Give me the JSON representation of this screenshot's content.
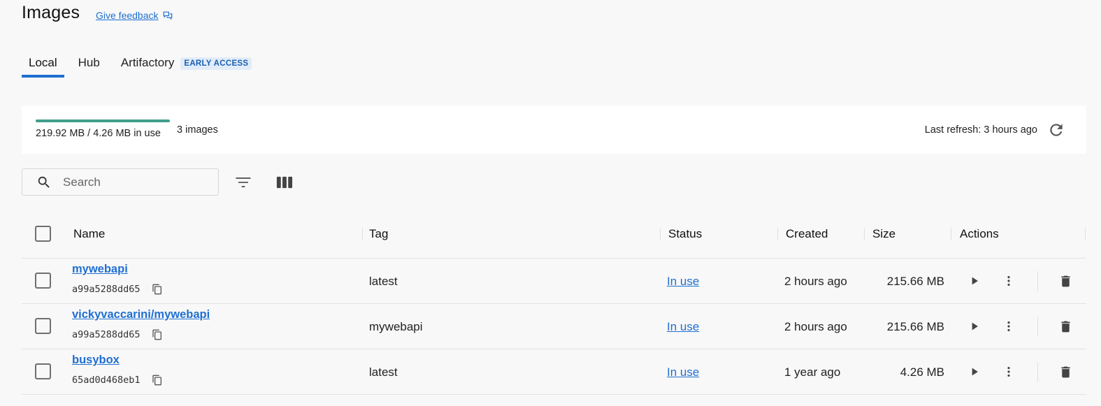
{
  "header": {
    "title": "Images",
    "feedback_label": "Give feedback"
  },
  "tabs": [
    {
      "label": "Local",
      "active": true
    },
    {
      "label": "Hub",
      "active": false
    },
    {
      "label": "Artifactory",
      "active": false,
      "badge": "EARLY ACCESS"
    }
  ],
  "usage": {
    "usage_text": "219.92 MB / 4.26 MB in use",
    "images_count": "3 images",
    "last_refresh": "Last refresh: 3 hours ago",
    "bar_color": "#3f9e8b"
  },
  "search": {
    "placeholder": "Search",
    "value": ""
  },
  "table": {
    "columns": [
      "Name",
      "Tag",
      "Status",
      "Created",
      "Size",
      "Actions"
    ],
    "rows": [
      {
        "name": "mywebapi",
        "id": "a99a5288dd65",
        "tag": "latest",
        "status": "In use",
        "created": "2 hours ago",
        "size": "215.66 MB"
      },
      {
        "name": "vickyvaccarini/mywebapi",
        "id": "a99a5288dd65",
        "tag": "mywebapi",
        "status": "In use",
        "created": "2 hours ago",
        "size": "215.66 MB"
      },
      {
        "name": "busybox",
        "id": "65ad0d468eb1",
        "tag": "latest",
        "status": "In use",
        "created": "1 year ago",
        "size": "4.26 MB"
      }
    ]
  },
  "colors": {
    "accent": "#1f6fd1",
    "background": "#f8f8f8",
    "panel": "#ffffff"
  }
}
